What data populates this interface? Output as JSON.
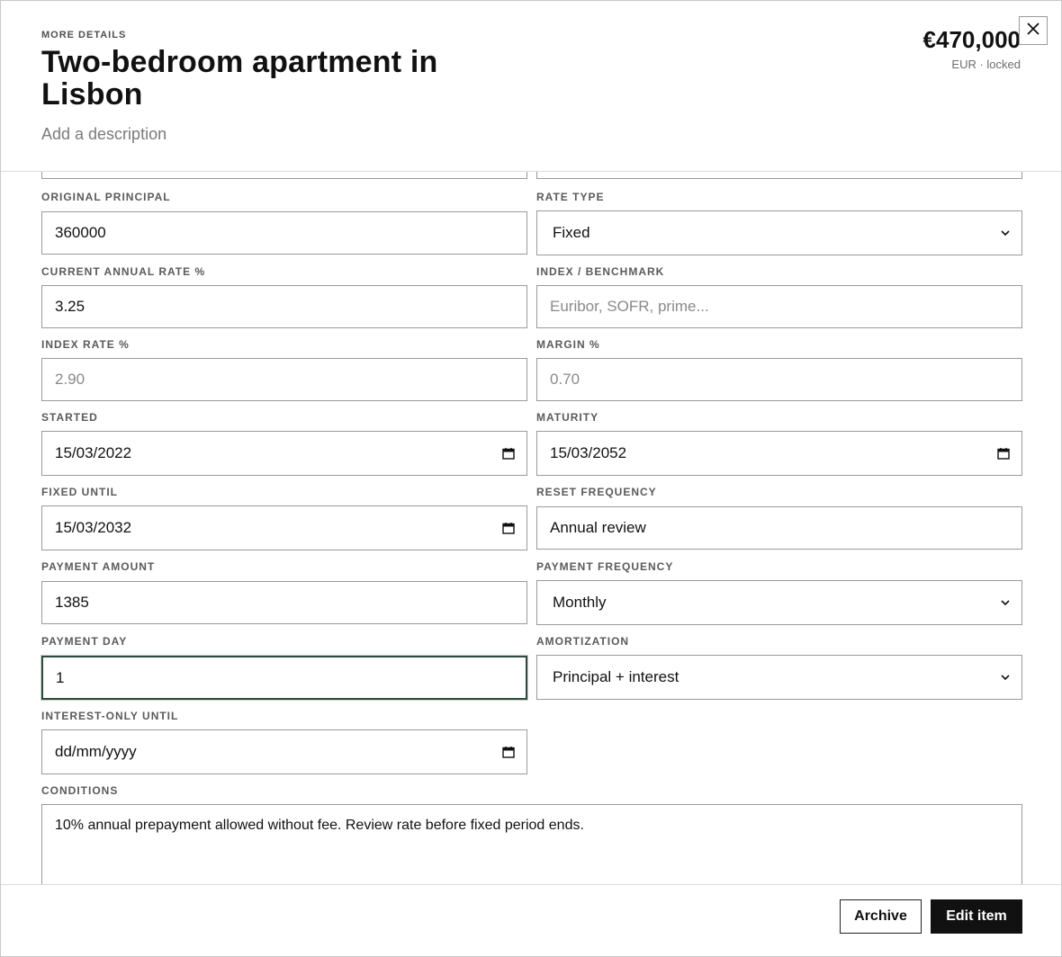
{
  "header": {
    "eyebrow": "MORE DETAILS",
    "title": "Two-bedroom apartment in Lisbon",
    "description_placeholder": "Add a description",
    "price": "€470,000",
    "price_sub": "EUR · locked",
    "close_icon": "close-icon"
  },
  "form": {
    "original_principal": {
      "label": "ORIGINAL PRINCIPAL",
      "value": "360000"
    },
    "rate_type": {
      "label": "RATE TYPE",
      "value": "Fixed"
    },
    "current_annual_rate": {
      "label": "CURRENT ANNUAL RATE %",
      "value": "3.25"
    },
    "index_benchmark": {
      "label": "INDEX / BENCHMARK",
      "placeholder": "Euribor, SOFR, prime..."
    },
    "index_rate": {
      "label": "INDEX RATE %",
      "placeholder": "2.90"
    },
    "margin": {
      "label": "MARGIN %",
      "placeholder": "0.70"
    },
    "started": {
      "label": "STARTED",
      "value": "15/03/2022"
    },
    "maturity": {
      "label": "MATURITY",
      "value": "15/03/2052"
    },
    "fixed_until": {
      "label": "FIXED UNTIL",
      "value": "15/03/2032"
    },
    "reset_frequency": {
      "label": "RESET FREQUENCY",
      "value": "Annual review"
    },
    "payment_amount": {
      "label": "PAYMENT AMOUNT",
      "value": "1385"
    },
    "payment_frequency": {
      "label": "PAYMENT FREQUENCY",
      "value": "Monthly"
    },
    "payment_day": {
      "label": "PAYMENT DAY",
      "value": "1"
    },
    "amortization": {
      "label": "AMORTIZATION",
      "value": "Principal + interest"
    },
    "interest_only_until": {
      "label": "INTEREST-ONLY UNTIL",
      "placeholder": "dd/mm/yyyy"
    },
    "conditions": {
      "label": "CONDITIONS",
      "value": "10% annual prepayment allowed without fee. Review rate before fixed period ends."
    }
  },
  "footer": {
    "archive_label": "Archive",
    "edit_label": "Edit item"
  },
  "colors": {
    "primary_button": "#111111",
    "focus_border": "#2f4a3e",
    "label_text": "#5a5a5a"
  }
}
